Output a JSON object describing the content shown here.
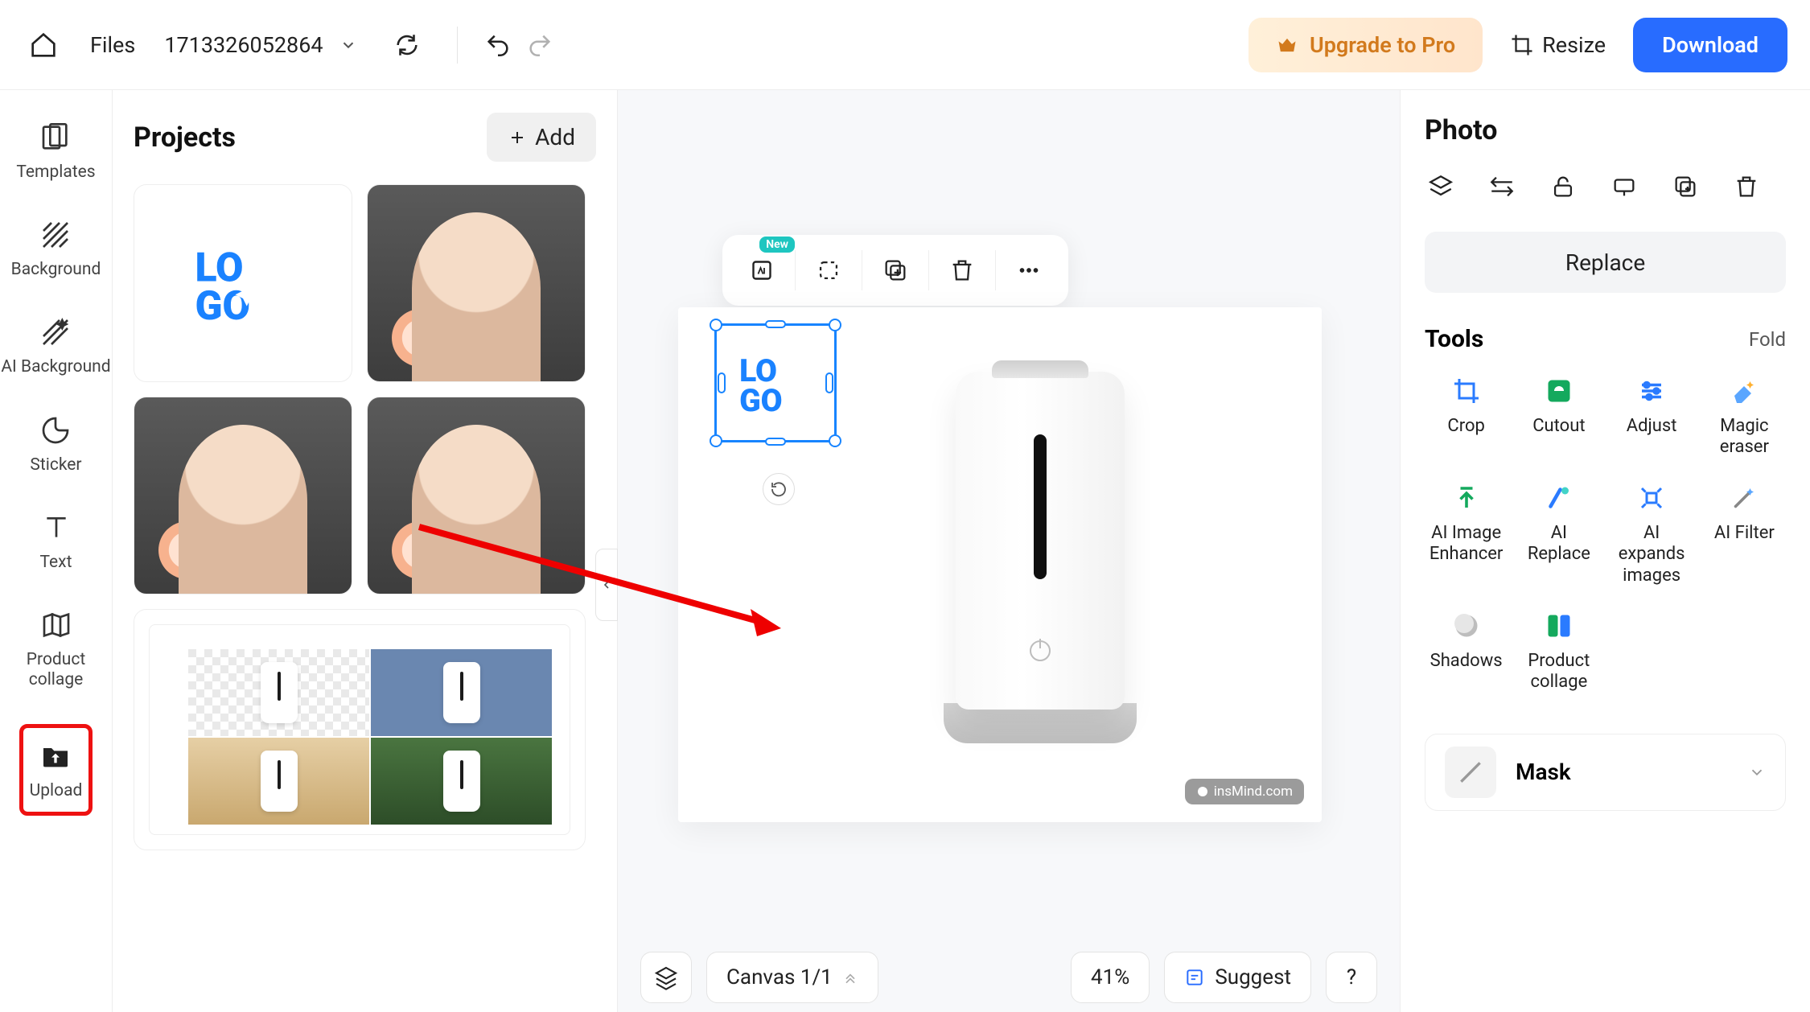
{
  "topbar": {
    "files_label": "Files",
    "doc_name": "1713326052864",
    "upgrade_label": "Upgrade to Pro",
    "resize_label": "Resize",
    "download_label": "Download"
  },
  "sidebar": {
    "items": [
      {
        "label": "Templates"
      },
      {
        "label": "Background"
      },
      {
        "label": "AI Background"
      },
      {
        "label": "Sticker"
      },
      {
        "label": "Text"
      },
      {
        "label": "Product collage"
      },
      {
        "label": "Upload"
      }
    ]
  },
  "projects": {
    "title": "Projects",
    "add_label": "Add"
  },
  "context_toolbar": {
    "ai_badge": "New"
  },
  "canvas": {
    "watermark": "insMind.com",
    "selected_logo_text": "LOGO"
  },
  "bottom_bar": {
    "canvas_label": "Canvas 1/1",
    "zoom": "41%",
    "suggest_label": "Suggest",
    "help": "?"
  },
  "right_panel": {
    "title": "Photo",
    "replace_label": "Replace",
    "tools_title": "Tools",
    "fold_label": "Fold",
    "tools": [
      {
        "label": "Crop"
      },
      {
        "label": "Cutout"
      },
      {
        "label": "Adjust"
      },
      {
        "label": "Magic eraser"
      },
      {
        "label": "AI Image Enhancer"
      },
      {
        "label": "AI Replace"
      },
      {
        "label": "AI expands images"
      },
      {
        "label": "AI Filter"
      },
      {
        "label": "Shadows"
      },
      {
        "label": "Product collage"
      }
    ],
    "mask_label": "Mask"
  }
}
